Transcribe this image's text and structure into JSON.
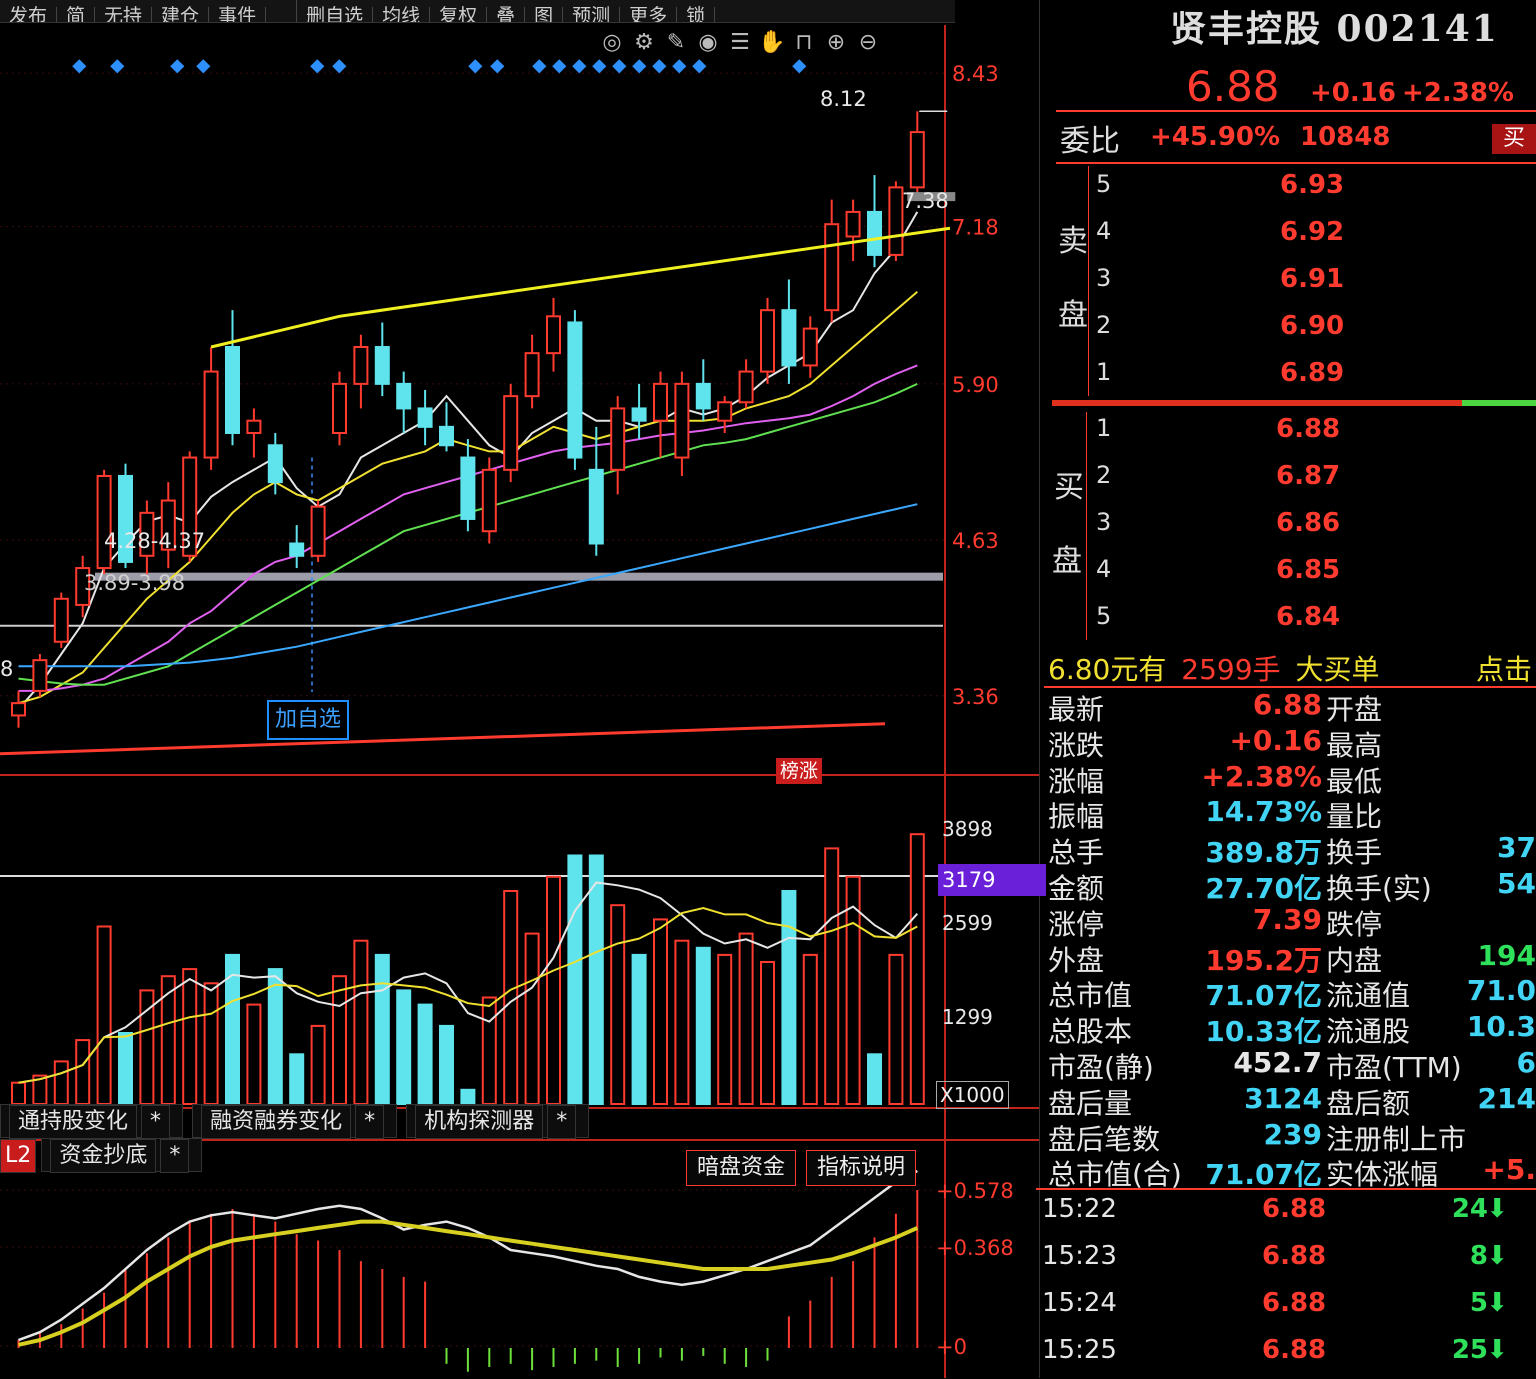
{
  "toolbar": {
    "menu_items": [
      "发布",
      "简",
      "无持",
      "建仓",
      "事件",
      "",
      "删自选",
      "均线",
      "复权",
      "叠",
      "图",
      "预测",
      "更多",
      "锁"
    ],
    "icons": [
      "target-icon",
      "gear-icon",
      "pen-icon",
      "eye-icon",
      "layers-icon",
      "hand-icon",
      "lock-icon",
      "zoom-in-icon",
      "zoom-out-icon"
    ]
  },
  "price_axis": {
    "labels": [
      "8.43",
      "7.18",
      "5.90",
      "4.63",
      "3.36"
    ]
  },
  "annotations": {
    "high_label": "8.12",
    "right_label": "7.38",
    "support_upper": "4.28-4.37",
    "support_lower": "3.89-3.98",
    "left_edge": "8",
    "add_self_button": "加自选",
    "bangzhang_badge": "榜涨"
  },
  "volume_axis": {
    "labels": [
      "3898",
      "2599",
      "1299"
    ],
    "highlight": "3179",
    "unit": "X1000"
  },
  "indicator_tabs": [
    "通持股变化",
    "融资融券变化",
    "机构探测器",
    "资金抄底"
  ],
  "l2_badge": "L2",
  "sub_buttons": {
    "dark_pool": "暗盘资金",
    "explain": "指标说明"
  },
  "indicator_axis": {
    "labels": [
      "+0.578",
      "+0.368",
      "+0"
    ]
  },
  "stock": {
    "name_code": "贤丰控股 002141",
    "price": "6.88",
    "change": "+0.16",
    "change_pct": "+2.38%"
  },
  "weibi": {
    "label": "委比",
    "pct": "+45.90%",
    "diff": "10848",
    "side_btn": "买"
  },
  "ask_label": [
    "卖",
    "盘"
  ],
  "bid_label": [
    "买",
    "盘"
  ],
  "asks": [
    {
      "level": "5",
      "price": "6.93"
    },
    {
      "level": "4",
      "price": "6.92"
    },
    {
      "level": "3",
      "price": "6.91"
    },
    {
      "level": "2",
      "price": "6.90"
    },
    {
      "level": "1",
      "price": "6.89"
    }
  ],
  "bids": [
    {
      "level": "1",
      "price": "6.88"
    },
    {
      "level": "2",
      "price": "6.87"
    },
    {
      "level": "3",
      "price": "6.86"
    },
    {
      "level": "4",
      "price": "6.85"
    },
    {
      "level": "5",
      "price": "6.84"
    }
  ],
  "big_order": {
    "price_text": "6.80元有",
    "qty": "2599手",
    "tag": "大买单",
    "action": "点击"
  },
  "quote": [
    {
      "l": "最新",
      "v": "6.88",
      "vc": "red",
      "l2": "开盘",
      "v2": ""
    },
    {
      "l": "涨跌",
      "v": "+0.16",
      "vc": "red",
      "l2": "最高",
      "v2": ""
    },
    {
      "l": "涨幅",
      "v": "+2.38%",
      "vc": "red",
      "l2": "最低",
      "v2": ""
    },
    {
      "l": "振幅",
      "v": "14.73%",
      "vc": "cyan",
      "l2": "量比",
      "v2": ""
    },
    {
      "l": "总手",
      "v": "389.8万",
      "vc": "cyan",
      "l2": "换手",
      "v2": "37"
    },
    {
      "l": "金额",
      "v": "27.70亿",
      "vc": "cyan",
      "l2": "换手(实)",
      "v2": "54"
    },
    {
      "l": "涨停",
      "v": "7.39",
      "vc": "red",
      "l2": "跌停",
      "v2": ""
    },
    {
      "l": "外盘",
      "v": "195.2万",
      "vc": "red",
      "l2": "内盘",
      "v2": "194"
    },
    {
      "l": "总市值",
      "v": "71.07亿",
      "vc": "cyan",
      "l2": "流通值",
      "v2": "71.0"
    },
    {
      "l": "总股本",
      "v": "10.33亿",
      "vc": "cyan",
      "l2": "流通股",
      "v2": "10.3"
    },
    {
      "l": "市盈(静)",
      "v": "452.7",
      "vc": "white",
      "l2": "市盈(TTM)",
      "v2": "6"
    },
    {
      "l": "盘后量",
      "v": "3124",
      "vc": "cyan",
      "l2": "盘后额",
      "v2": "214"
    },
    {
      "l": "盘后笔数",
      "v": "239",
      "vc": "cyan",
      "l2": "注册制上市",
      "v2": ""
    },
    {
      "l": "总市值(合)",
      "v": "71.07亿",
      "vc": "cyan",
      "l2": "实体涨幅",
      "v2": "+5."
    }
  ],
  "ticks": [
    {
      "time": "15:22",
      "price": "6.88",
      "vol": "24"
    },
    {
      "time": "15:23",
      "price": "6.88",
      "vol": "8"
    },
    {
      "time": "15:24",
      "price": "6.88",
      "vol": "5"
    },
    {
      "time": "15:25",
      "price": "6.88",
      "vol": "25"
    }
  ],
  "colors": {
    "up": "#ff3b2f",
    "down": "#5fe3ec",
    "ma5": "#e6e6e6",
    "ma10": "#f0e030",
    "ma20": "#e060f0",
    "ma30": "#60e050",
    "ma60": "#3aa8ff",
    "trend": "#f0f020",
    "grid": "#3a0c0c"
  },
  "chart_data": {
    "type": "candlestick",
    "y_axis_ticks": [
      8.43,
      7.18,
      5.9,
      4.63,
      3.36
    ],
    "ylim": [
      3.0,
      8.7
    ],
    "candles": [
      {
        "o": 3.2,
        "h": 3.4,
        "l": 3.1,
        "c": 3.3
      },
      {
        "o": 3.4,
        "h": 3.7,
        "l": 3.35,
        "c": 3.65
      },
      {
        "o": 3.8,
        "h": 4.2,
        "l": 3.75,
        "c": 4.15
      },
      {
        "o": 4.1,
        "h": 4.5,
        "l": 4.0,
        "c": 4.4
      },
      {
        "o": 4.4,
        "h": 5.2,
        "l": 4.35,
        "c": 5.15
      },
      {
        "o": 5.15,
        "h": 5.25,
        "l": 4.4,
        "c": 4.45
      },
      {
        "o": 4.5,
        "h": 4.95,
        "l": 4.35,
        "c": 4.85
      },
      {
        "o": 4.55,
        "h": 5.1,
        "l": 4.4,
        "c": 4.95
      },
      {
        "o": 4.5,
        "h": 5.35,
        "l": 4.45,
        "c": 5.3
      },
      {
        "o": 5.3,
        "h": 6.2,
        "l": 5.2,
        "c": 6.0
      },
      {
        "o": 6.2,
        "h": 6.5,
        "l": 5.4,
        "c": 5.5
      },
      {
        "o": 5.5,
        "h": 5.7,
        "l": 5.3,
        "c": 5.6
      },
      {
        "o": 5.4,
        "h": 5.5,
        "l": 5.0,
        "c": 5.1
      },
      {
        "o": 4.6,
        "h": 4.75,
        "l": 4.4,
        "c": 4.5
      },
      {
        "o": 4.5,
        "h": 4.95,
        "l": 4.45,
        "c": 4.9
      },
      {
        "o": 5.5,
        "h": 6.0,
        "l": 5.4,
        "c": 5.9
      },
      {
        "o": 5.9,
        "h": 6.3,
        "l": 5.7,
        "c": 6.2
      },
      {
        "o": 6.2,
        "h": 6.4,
        "l": 5.8,
        "c": 5.9
      },
      {
        "o": 5.9,
        "h": 6.0,
        "l": 5.5,
        "c": 5.7
      },
      {
        "o": 5.7,
        "h": 5.85,
        "l": 5.4,
        "c": 5.55
      },
      {
        "o": 5.55,
        "h": 5.75,
        "l": 5.35,
        "c": 5.4
      },
      {
        "o": 5.3,
        "h": 5.45,
        "l": 4.7,
        "c": 4.8
      },
      {
        "o": 4.7,
        "h": 5.3,
        "l": 4.6,
        "c": 5.2
      },
      {
        "o": 5.2,
        "h": 5.9,
        "l": 5.1,
        "c": 5.8
      },
      {
        "o": 5.8,
        "h": 6.3,
        "l": 5.7,
        "c": 6.15
      },
      {
        "o": 6.15,
        "h": 6.6,
        "l": 6.0,
        "c": 6.45
      },
      {
        "o": 6.4,
        "h": 6.5,
        "l": 5.2,
        "c": 5.3
      },
      {
        "o": 5.2,
        "h": 5.55,
        "l": 4.5,
        "c": 4.6
      },
      {
        "o": 5.2,
        "h": 5.8,
        "l": 5.0,
        "c": 5.7
      },
      {
        "o": 5.7,
        "h": 5.9,
        "l": 5.45,
        "c": 5.6
      },
      {
        "o": 5.6,
        "h": 6.0,
        "l": 5.3,
        "c": 5.9
      },
      {
        "o": 5.3,
        "h": 6.0,
        "l": 5.15,
        "c": 5.9
      },
      {
        "o": 5.9,
        "h": 6.1,
        "l": 5.6,
        "c": 5.7
      },
      {
        "o": 5.6,
        "h": 5.8,
        "l": 5.5,
        "c": 5.75
      },
      {
        "o": 5.75,
        "h": 6.1,
        "l": 5.7,
        "c": 6.0
      },
      {
        "o": 6.0,
        "h": 6.6,
        "l": 5.9,
        "c": 6.5
      },
      {
        "o": 6.5,
        "h": 6.75,
        "l": 5.9,
        "c": 6.05
      },
      {
        "o": 6.05,
        "h": 6.45,
        "l": 5.95,
        "c": 6.35
      },
      {
        "o": 6.5,
        "h": 7.4,
        "l": 6.4,
        "c": 7.2
      },
      {
        "o": 7.1,
        "h": 7.4,
        "l": 6.9,
        "c": 7.3
      },
      {
        "o": 7.3,
        "h": 7.6,
        "l": 6.85,
        "c": 6.95
      },
      {
        "o": 6.95,
        "h": 7.55,
        "l": 6.9,
        "c": 7.5
      },
      {
        "o": 7.5,
        "h": 8.12,
        "l": 7.4,
        "c": 7.95
      }
    ],
    "volumes": [
      0.3,
      0.4,
      0.6,
      0.9,
      2.5,
      1.0,
      1.6,
      1.8,
      1.9,
      1.7,
      2.1,
      1.4,
      1.9,
      0.7,
      1.1,
      1.8,
      2.3,
      2.1,
      1.6,
      1.4,
      1.1,
      0.2,
      1.5,
      3.0,
      2.4,
      3.2,
      3.5,
      3.5,
      2.8,
      2.1,
      2.6,
      2.3,
      2.2,
      2.1,
      2.4,
      2.0,
      3.0,
      2.1,
      3.6,
      3.2,
      0.7,
      2.1,
      3.8
    ],
    "volume_ylim": [
      0,
      4.0
    ],
    "series": [
      {
        "name": "MA5",
        "values": [
          3.25,
          3.45,
          3.7,
          3.95,
          4.4,
          4.6,
          4.78,
          4.83,
          4.77,
          4.98,
          5.1,
          5.2,
          5.3,
          5.05,
          4.9,
          5.0,
          5.3,
          5.4,
          5.5,
          5.6,
          5.8,
          5.6,
          5.4,
          5.3,
          5.5,
          5.6,
          5.7,
          5.6,
          5.6,
          5.55,
          5.6,
          5.7,
          5.65,
          5.7,
          5.8,
          5.95,
          6.05,
          6.15,
          6.4,
          6.5,
          6.8,
          7.0,
          7.3
        ]
      },
      {
        "name": "MA10",
        "values": [
          3.3,
          3.35,
          3.45,
          3.55,
          3.75,
          3.95,
          4.15,
          4.3,
          4.45,
          4.65,
          4.85,
          5.0,
          5.1,
          5.0,
          4.95,
          5.05,
          5.15,
          5.25,
          5.3,
          5.35,
          5.45,
          5.4,
          5.35,
          5.35,
          5.45,
          5.55,
          5.5,
          5.45,
          5.5,
          5.55,
          5.6,
          5.6,
          5.6,
          5.62,
          5.7,
          5.75,
          5.8,
          5.9,
          6.05,
          6.2,
          6.35,
          6.5,
          6.65
        ]
      },
      {
        "name": "MA20",
        "values": [
          3.4,
          3.4,
          3.42,
          3.45,
          3.5,
          3.6,
          3.7,
          3.8,
          3.95,
          4.05,
          4.2,
          4.35,
          4.45,
          4.5,
          4.6,
          4.7,
          4.8,
          4.9,
          5.0,
          5.05,
          5.1,
          5.15,
          5.2,
          5.25,
          5.3,
          5.35,
          5.38,
          5.4,
          5.42,
          5.45,
          5.48,
          5.5,
          5.52,
          5.55,
          5.58,
          5.6,
          5.62,
          5.65,
          5.72,
          5.8,
          5.9,
          5.98,
          6.05
        ]
      },
      {
        "name": "MA30",
        "values": [
          3.5,
          3.48,
          3.46,
          3.45,
          3.45,
          3.5,
          3.55,
          3.6,
          3.7,
          3.8,
          3.9,
          4.0,
          4.1,
          4.2,
          4.3,
          4.4,
          4.5,
          4.6,
          4.7,
          4.75,
          4.8,
          4.85,
          4.9,
          4.95,
          5.0,
          5.05,
          5.1,
          5.15,
          5.2,
          5.25,
          5.3,
          5.35,
          5.4,
          5.42,
          5.45,
          5.5,
          5.55,
          5.6,
          5.65,
          5.7,
          5.75,
          5.82,
          5.9
        ]
      },
      {
        "name": "MA60",
        "values": [
          3.6,
          3.6,
          3.6,
          3.6,
          3.6,
          3.6,
          3.61,
          3.62,
          3.63,
          3.65,
          3.67,
          3.7,
          3.73,
          3.76,
          3.8,
          3.84,
          3.88,
          3.92,
          3.96,
          4.0,
          4.04,
          4.08,
          4.12,
          4.16,
          4.2,
          4.24,
          4.28,
          4.32,
          4.36,
          4.4,
          4.44,
          4.48,
          4.52,
          4.56,
          4.6,
          4.64,
          4.68,
          4.72,
          4.76,
          4.8,
          4.84,
          4.88,
          4.92
        ]
      }
    ]
  }
}
